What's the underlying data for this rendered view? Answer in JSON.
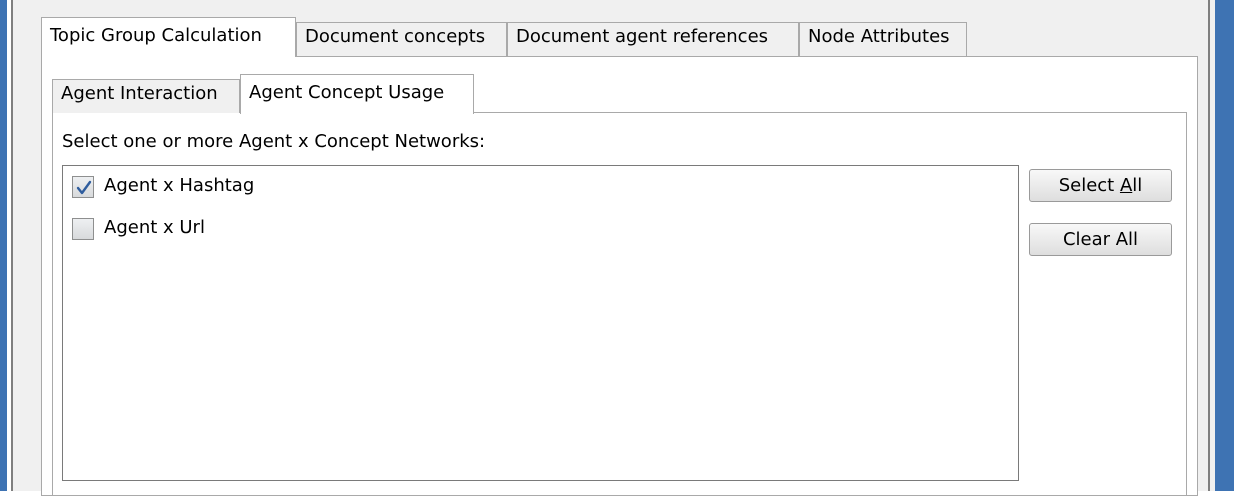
{
  "outer_tabs": [
    {
      "label": "Topic Group Calculation",
      "selected": true
    },
    {
      "label": "Document concepts",
      "selected": false
    },
    {
      "label": "Document agent references",
      "selected": false
    },
    {
      "label": "Node Attributes",
      "selected": false
    }
  ],
  "inner_tabs": [
    {
      "label": "Agent Interaction",
      "selected": false
    },
    {
      "label": "Agent Concept Usage",
      "selected": true
    }
  ],
  "prompt": "Select one or more Agent x Concept Networks:",
  "networks": [
    {
      "label": "Agent x Hashtag",
      "checked": true
    },
    {
      "label": "Agent x Url",
      "checked": false
    }
  ],
  "buttons": {
    "select_all": {
      "before": "Select ",
      "mnemonic": "A",
      "after": "ll"
    },
    "clear_all": "Clear All"
  }
}
